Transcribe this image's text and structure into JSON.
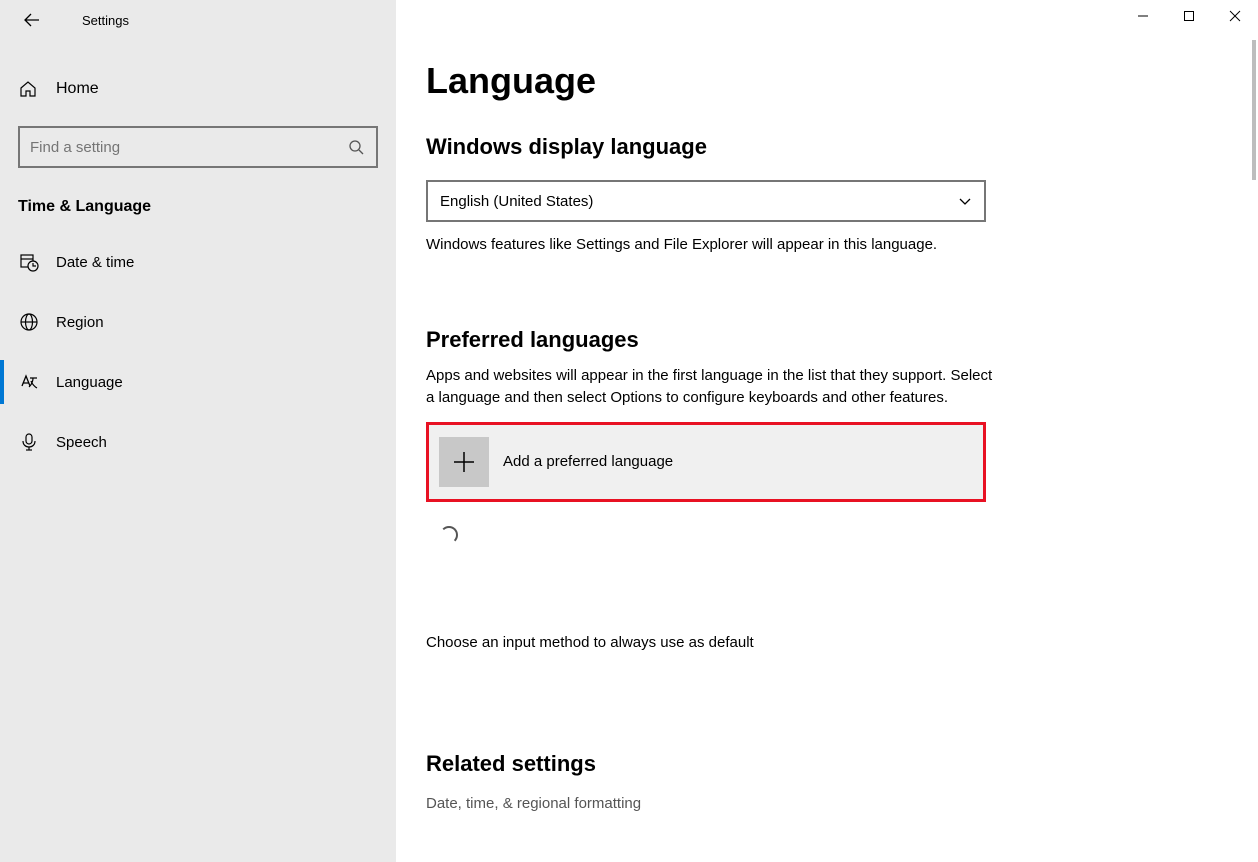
{
  "app_title": "Settings",
  "home_label": "Home",
  "search_placeholder": "Find a setting",
  "category": "Time & Language",
  "nav": {
    "date_time": "Date & time",
    "region": "Region",
    "language": "Language",
    "speech": "Speech"
  },
  "page_title": "Language",
  "display_lang": {
    "title": "Windows display language",
    "value": "English (United States)",
    "desc": "Windows features like Settings and File Explorer will appear in this language."
  },
  "preferred": {
    "title": "Preferred languages",
    "desc": "Apps and websites will appear in the first language in the list that they support. Select a language and then select Options to configure keyboards and other features.",
    "add_label": "Add a preferred language"
  },
  "input_method_link": "Choose an input method to always use as default",
  "related": {
    "title": "Related settings",
    "item1": "Date, time, & regional formatting"
  }
}
